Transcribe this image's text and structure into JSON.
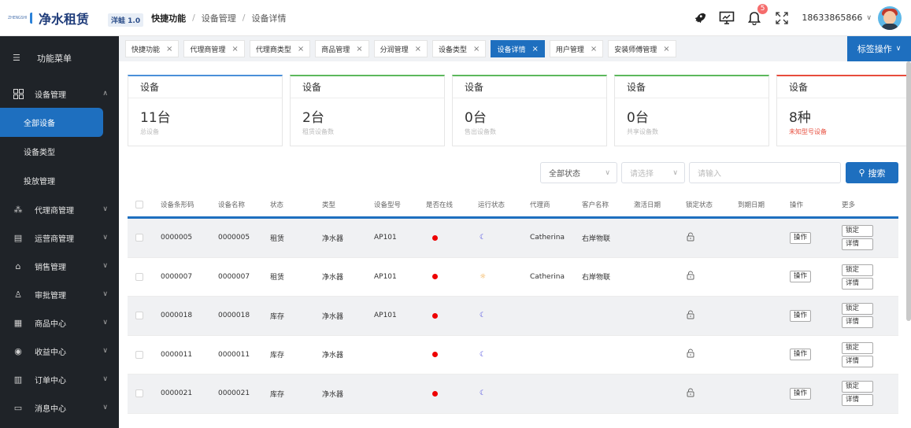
{
  "header": {
    "logo_small_text": "ZHENGSHUI RENT",
    "logo_text": "净水租赁",
    "version": "洋蛙 1.0",
    "breadcrumb": [
      "快捷功能",
      "设备管理",
      "设备详情"
    ],
    "notification_count": "5",
    "username": "18633865866",
    "icons": [
      "rocket-icon",
      "monitor-icon",
      "bell-icon",
      "fullscreen-icon",
      "chevron-down-icon"
    ]
  },
  "sidebar": {
    "title": "功能菜单",
    "items": [
      {
        "label": "设备管理",
        "icon": "grid-icon",
        "expanded": true,
        "children": [
          "全部设备",
          "设备类型",
          "投放管理"
        ]
      },
      {
        "label": "代理商管理",
        "icon": "network-icon"
      },
      {
        "label": "运营商管理",
        "icon": "building-icon"
      },
      {
        "label": "销售管理",
        "icon": "tag-icon"
      },
      {
        "label": "审批管理",
        "icon": "stamp-icon"
      },
      {
        "label": "商品中心",
        "icon": "box-icon"
      },
      {
        "label": "收益中心",
        "icon": "money-icon"
      },
      {
        "label": "订单中心",
        "icon": "order-icon"
      },
      {
        "label": "消息中心",
        "icon": "message-icon"
      }
    ]
  },
  "tabs": [
    {
      "label": "快捷功能",
      "active": false
    },
    {
      "label": "代理商管理",
      "active": false
    },
    {
      "label": "代理商类型",
      "active": false
    },
    {
      "label": "商品管理",
      "active": false
    },
    {
      "label": "分润管理",
      "active": false
    },
    {
      "label": "设备类型",
      "active": false
    },
    {
      "label": "设备详情",
      "active": true
    },
    {
      "label": "用户管理",
      "active": false
    },
    {
      "label": "安装师傅管理",
      "active": false
    }
  ],
  "tag_ops_label": "标签操作",
  "cards": [
    {
      "title": "设备",
      "value": "11台",
      "sub": "总设备"
    },
    {
      "title": "设备",
      "value": "2台",
      "sub": "租赁设备数"
    },
    {
      "title": "设备",
      "value": "0台",
      "sub": "售出设备数"
    },
    {
      "title": "设备",
      "value": "0台",
      "sub": "共享设备数"
    },
    {
      "title": "设备",
      "value": "8种",
      "sub": "未知型号设备"
    }
  ],
  "card_colors": [
    "#4a90d9",
    "#5cb85c",
    "#5cb85c",
    "#5cb85c",
    "#e74c3c"
  ],
  "filters": {
    "status": "全部状态",
    "select_placeholder": "请选择",
    "input_placeholder": "请输入",
    "search_label": "搜索"
  },
  "table": {
    "headers": [
      "设备条形码",
      "设备名称",
      "状态",
      "类型",
      "设备型号",
      "是否在线",
      "运行状态",
      "代理商",
      "客户名称",
      "激活日期",
      "锁定状态",
      "到期日期",
      "操作",
      "更多"
    ],
    "op_label": "操作",
    "lock_label": "锁定",
    "detail_label": "详情",
    "rows": [
      {
        "barcode": "0000005",
        "name": "0000005",
        "status": "租赁",
        "type": "净水器",
        "model": "AP101",
        "online": "offline",
        "run": "moon",
        "agent": "Catherina",
        "customer": "右岸物联"
      },
      {
        "barcode": "0000007",
        "name": "0000007",
        "status": "租赁",
        "type": "净水器",
        "model": "AP101",
        "online": "offline",
        "run": "sun",
        "agent": "Catherina",
        "customer": "右岸物联"
      },
      {
        "barcode": "0000018",
        "name": "0000018",
        "status": "库存",
        "type": "净水器",
        "model": "AP101",
        "online": "offline",
        "run": "moon",
        "agent": "",
        "customer": ""
      },
      {
        "barcode": "0000011",
        "name": "0000011",
        "status": "库存",
        "type": "净水器",
        "model": "",
        "online": "offline",
        "run": "moon",
        "agent": "",
        "customer": ""
      },
      {
        "barcode": "0000021",
        "name": "0000021",
        "status": "库存",
        "type": "净水器",
        "model": "",
        "online": "offline",
        "run": "moon",
        "agent": "",
        "customer": ""
      }
    ]
  }
}
